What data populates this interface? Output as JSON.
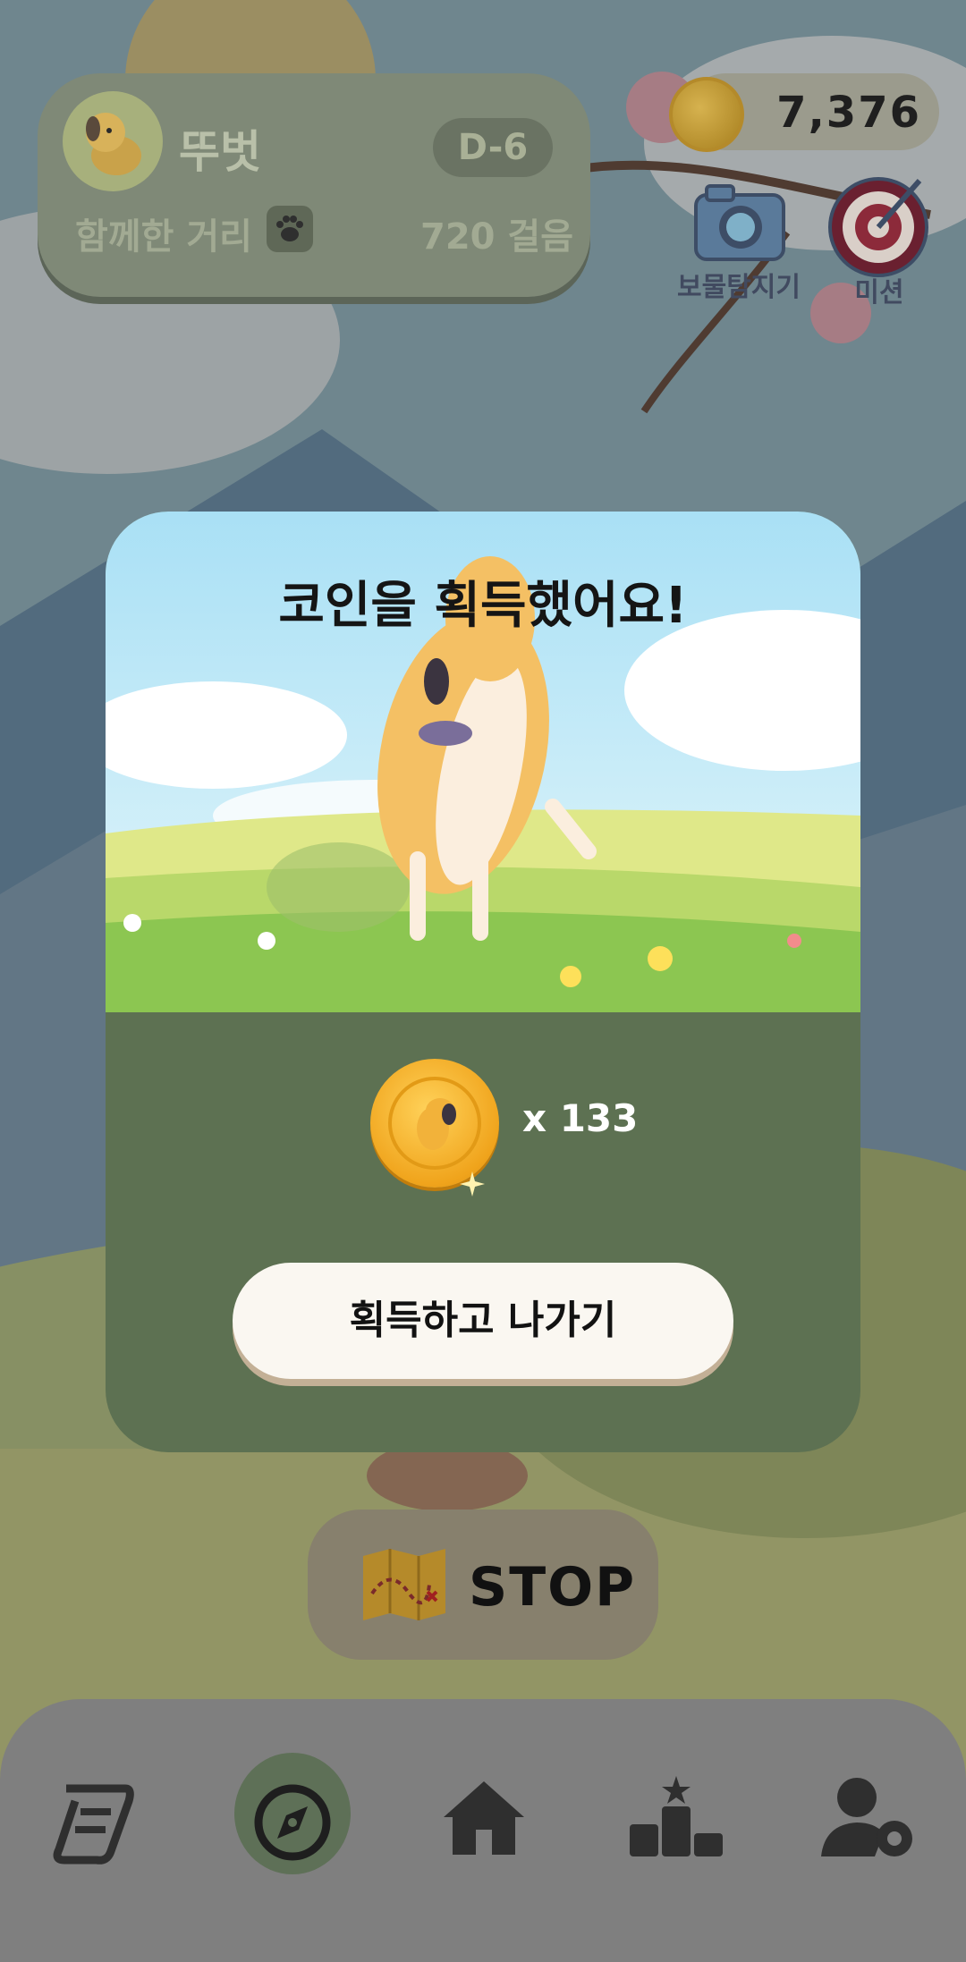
{
  "profile": {
    "name": "뚜벗",
    "dday": "D-6",
    "distance_label": "함께한 거리",
    "steps": "720 걸음"
  },
  "coins": {
    "total": "7,376"
  },
  "top_actions": [
    {
      "label": "보물탐지기",
      "icon": "camera-icon"
    },
    {
      "label": "미션",
      "icon": "target-icon"
    }
  ],
  "modal": {
    "title": "코인을 획득했어요!",
    "reward_count": "x 133",
    "claim_button": "획득하고 나가기"
  },
  "stop_button": {
    "label": "STOP",
    "icon": "treasure-map-icon"
  },
  "bottom_nav": [
    {
      "icon": "scroll-icon",
      "active": false
    },
    {
      "icon": "compass-icon",
      "active": true
    },
    {
      "icon": "home-icon",
      "active": false
    },
    {
      "icon": "ranking-icon",
      "active": false
    },
    {
      "icon": "user-settings-icon",
      "active": false
    }
  ],
  "colors": {
    "modal_bottom": "#5d7152",
    "claim_button_bg": "#faf7f1",
    "coin_gold": "#f0a41c"
  }
}
